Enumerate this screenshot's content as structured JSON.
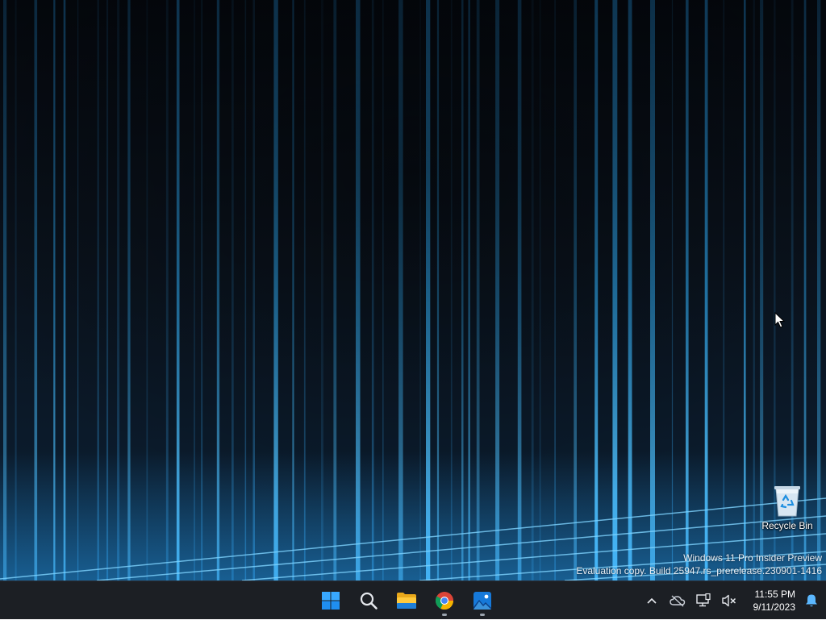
{
  "desktop": {
    "recycle_bin_label": "Recycle Bin",
    "watermark_line1": "Windows 11 Pro Insider Preview",
    "watermark_line2": "Evaluation copy. Build 25947.rs_prerelease.230901-1416"
  },
  "taskbar": {
    "apps": [
      {
        "name": "start",
        "icon": "windows-logo-icon",
        "running": false
      },
      {
        "name": "search",
        "icon": "search-icon",
        "running": false
      },
      {
        "name": "file-explorer",
        "icon": "folder-icon",
        "running": false
      },
      {
        "name": "chrome",
        "icon": "chrome-icon",
        "running": true
      },
      {
        "name": "photos",
        "icon": "photos-icon",
        "running": true
      }
    ],
    "tray": {
      "icons": [
        "chevron-up-icon",
        "onedrive-offline-icon",
        "network-icon",
        "volume-muted-icon"
      ],
      "time": "11:55 PM",
      "date": "9/11/2023",
      "notification_icon": "bell-icon"
    }
  },
  "colors": {
    "taskbar_bg": "#1c1f24",
    "wallpaper_accent": "#35b6ff",
    "windows_blue": "#0b84e8"
  }
}
